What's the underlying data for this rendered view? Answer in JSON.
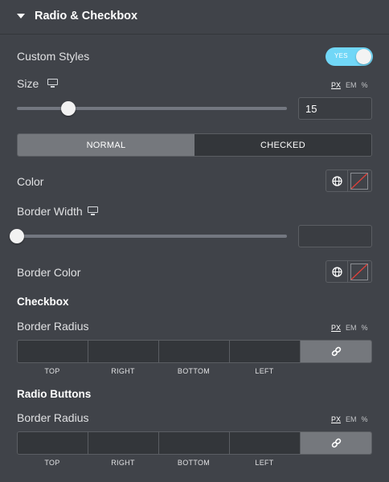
{
  "section": {
    "title": "Radio & Checkbox"
  },
  "custom_styles": {
    "label": "Custom Styles",
    "toggle_text": "YES",
    "enabled": true
  },
  "size": {
    "label": "Size",
    "units": [
      "PX",
      "EM",
      "%"
    ],
    "active_unit": "PX",
    "value": "15"
  },
  "tabs": [
    {
      "label": "NORMAL",
      "active": true
    },
    {
      "label": "CHECKED",
      "active": false
    }
  ],
  "color": {
    "label": "Color"
  },
  "border_width": {
    "label": "Border Width",
    "value": ""
  },
  "border_color": {
    "label": "Border Color"
  },
  "checkbox": {
    "heading": "Checkbox",
    "radius_label": "Border Radius",
    "units": [
      "PX",
      "EM",
      "%"
    ],
    "sides": [
      "TOP",
      "RIGHT",
      "BOTTOM",
      "LEFT"
    ]
  },
  "radio": {
    "heading": "Radio Buttons",
    "radius_label": "Border Radius",
    "units": [
      "PX",
      "EM",
      "%"
    ],
    "sides": [
      "TOP",
      "RIGHT",
      "BOTTOM",
      "LEFT"
    ]
  },
  "colors": {
    "toggle_on": "#71d7f7",
    "background": "#404349",
    "tab_active": "#75787d",
    "clear_swatch_line": "#e0403a"
  }
}
